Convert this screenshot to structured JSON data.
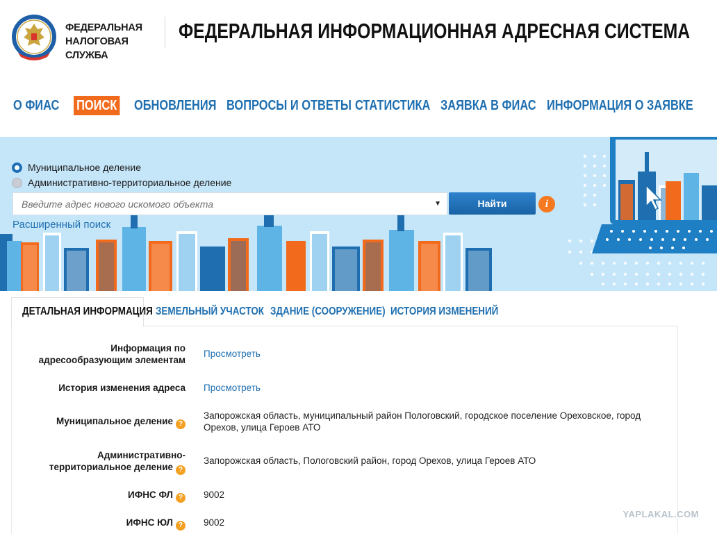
{
  "header": {
    "fns_line1": "ФЕДЕРАЛЬНАЯ",
    "fns_line2": "НАЛОГОВАЯ СЛУЖБА",
    "site_title": "ФЕДЕРАЛЬНАЯ ИНФОРМАЦИОННАЯ АДРЕСНАЯ СИСТЕМА",
    "logo_icon": "fns-emblem-icon"
  },
  "nav": {
    "items": [
      {
        "label": "О ФИАС"
      },
      {
        "label": "ПОИСК",
        "active": true
      },
      {
        "label": "ОБНОВЛЕНИЯ"
      },
      {
        "label": "ВОПРОСЫ И ОТВЕТЫ"
      },
      {
        "label": "СТАТИСТИКА"
      },
      {
        "label": "ЗАЯВКА В ФИАС"
      },
      {
        "label": "ИНФОРМАЦИЯ О ЗАЯВКЕ"
      }
    ]
  },
  "search": {
    "radio_municipal": "Муниципальное деление",
    "radio_admin": "Административно-территориальное деление",
    "placeholder": "Введите адрес нового искомого объекта",
    "value": "",
    "button": "Найти",
    "info": "i",
    "advanced": "Расширенный поиск"
  },
  "tabs": [
    {
      "label": "ДЕТАЛЬНАЯ ИНФОРМАЦИЯ",
      "active": true
    },
    {
      "label": "ЗЕМЕЛЬНЫЙ УЧАСТОК"
    },
    {
      "label": "ЗДАНИЕ (СООРУЖЕНИЕ)"
    },
    {
      "label": "ИСТОРИЯ ИЗМЕНЕНИЙ"
    }
  ],
  "details": {
    "addr_elements_label_1": "Информация по",
    "addr_elements_label_2": "адресообразующим элементам",
    "addr_elements_value": "Просмотреть",
    "history_label": "История изменения адреса",
    "history_value": "Просмотреть",
    "municipal_label": "Муниципальное деление",
    "municipal_value": "Запорожская область, муниципальный район Пологовский, городское поселение Ореховское, город Орехов, улица Героев АТО",
    "admin_label_1": "Административно-",
    "admin_label_2": "территориальное деление",
    "admin_value": "Запорожская область, Пологовский район, город Орехов, улица Героев АТО",
    "ifns_fl_label": "ИФНС ФЛ",
    "ifns_fl_value": "9002",
    "ifns_ul_label": "ИФНС ЮЛ",
    "ifns_ul_value": "9002",
    "help_mark": "?"
  },
  "watermark": "YAPLAKAL.COM",
  "colors": {
    "accent_blue": "#1f6fb0",
    "active_orange": "#f26b1d",
    "banner_bg": "#c5e6f9",
    "help_orange": "#f4a020"
  }
}
